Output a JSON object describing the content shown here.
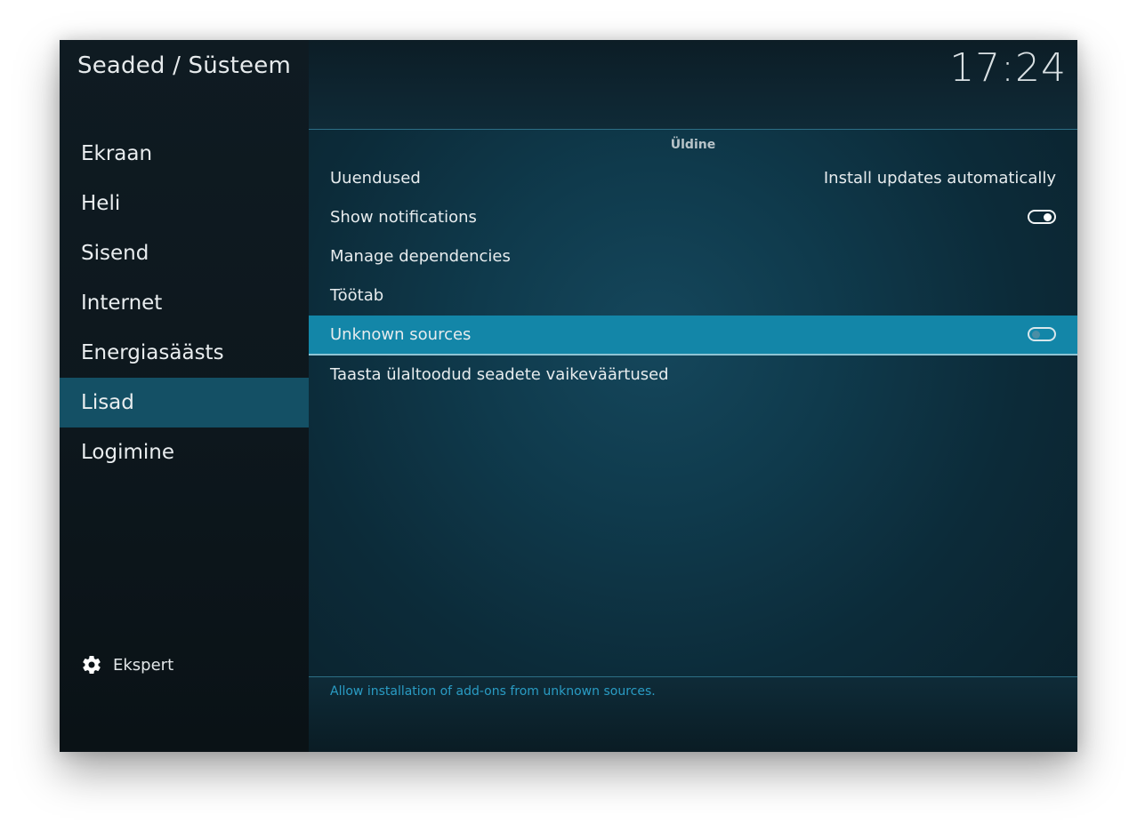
{
  "window": {
    "title": "Seaded / Süsteem",
    "clock": "17:24"
  },
  "sidebar": {
    "items": [
      {
        "label": "Ekraan",
        "active": false
      },
      {
        "label": "Heli",
        "active": false
      },
      {
        "label": "Sisend",
        "active": false
      },
      {
        "label": "Internet",
        "active": false
      },
      {
        "label": "Energiasäästs",
        "active": false
      },
      {
        "label": "Lisad",
        "active": true
      },
      {
        "label": "Logimine",
        "active": false
      }
    ],
    "expert": {
      "label": "Ekspert",
      "icon": "gear-icon"
    }
  },
  "section": {
    "title": "Üldine"
  },
  "settings": {
    "rows": [
      {
        "label": "Uuendused",
        "value": "Install updates automatically"
      },
      {
        "label": "Show notifications",
        "toggle": "on"
      },
      {
        "label": "Manage dependencies"
      },
      {
        "label": "Töötab"
      },
      {
        "label": "Unknown sources",
        "toggle": "off",
        "selected": true
      },
      {
        "label": "Taasta ülaltoodud seadete vaikeväärtused"
      }
    ]
  },
  "footer": {
    "description": "Allow installation of add-ons from unknown sources."
  },
  "colors": {
    "accent": "#1386a8",
    "sidebar_active": "#145065",
    "description_text": "#2a9cc4"
  }
}
